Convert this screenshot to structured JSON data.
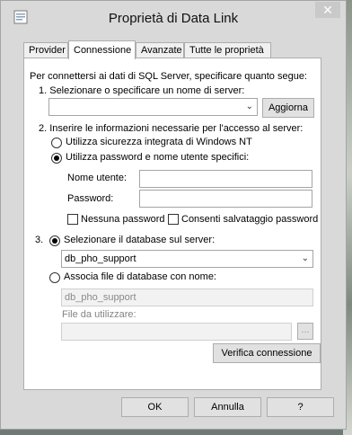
{
  "window": {
    "title": "Proprietà di Data Link",
    "close_glyph": "✕"
  },
  "tabs": [
    {
      "label": "Provider"
    },
    {
      "label": "Connessione"
    },
    {
      "label": "Avanzate"
    },
    {
      "label": "Tutte le proprietà"
    }
  ],
  "active_tab": "Connessione",
  "intro": "Per connettersi ai dati di SQL Server, specificare quanto segue:",
  "step1": {
    "label": "1. Selezionare o specificare un nome di server:",
    "server_value": "",
    "refresh_button": "Aggiorna"
  },
  "step2": {
    "label": "2. Inserire le informazioni necessarie per l'accesso al server:",
    "option_nt": "Utilizza sicurezza integrata di Windows NT",
    "option_user": "Utilizza password e nome utente specifici:",
    "selected": "option_user",
    "username_label": "Nome utente:",
    "username_value": "",
    "password_label": "Password:",
    "password_value": "",
    "no_password": "Nessuna password",
    "allow_save": "Consenti salvataggio password"
  },
  "step3": {
    "number": "3.",
    "option_db": "Selezionare il database sul server:",
    "db_value": "db_pho_support",
    "option_attach": "Associa file di database con nome:",
    "attach_value": "db_pho_support",
    "file_label": "File da utilizzare:",
    "file_value": "",
    "browse_label": "...",
    "test_button": "Verifica connessione"
  },
  "footer": {
    "ok": "OK",
    "cancel": "Annulla",
    "help": "?"
  }
}
